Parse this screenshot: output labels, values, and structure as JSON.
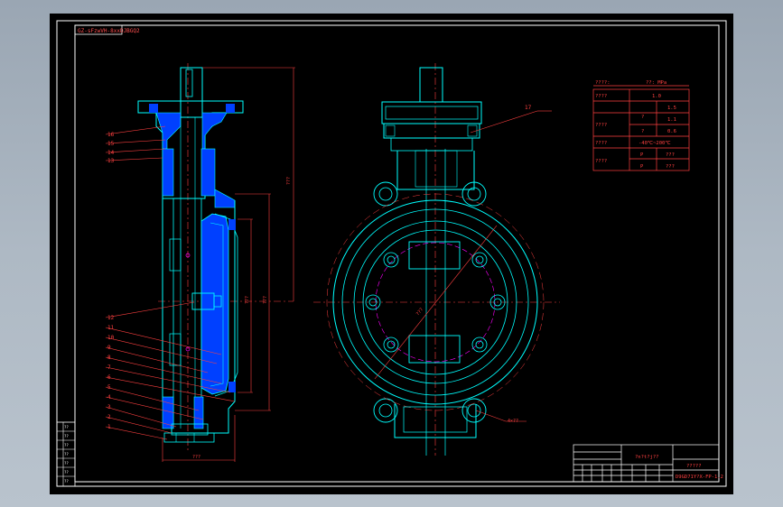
{
  "drawing": {
    "corner_code": "GZ-sFzwVH-8xxDJBGQ2",
    "spec_table": {
      "header_left": "????:",
      "header_right": "??:  MPa",
      "rows": [
        {
          "label": "????",
          "sub": "",
          "value": "1.0"
        },
        {
          "label": "????",
          "sub": "?",
          "value": "1.5"
        },
        {
          "label": "",
          "sub": "",
          "value": "1.1"
        },
        {
          "label": "",
          "sub": "?",
          "value": "0.6"
        },
        {
          "label": "????",
          "sub": "",
          "value": "-40℃~200℃"
        },
        {
          "label": "????",
          "sub": "P",
          "value": "???"
        },
        {
          "label": "",
          "sub": "P",
          "value": "???"
        }
      ]
    },
    "part_numbers_upper": [
      "16",
      "15",
      "14",
      "13"
    ],
    "part_numbers_lower": [
      "12",
      "11",
      "10",
      "9",
      "8",
      "7",
      "6",
      "5",
      "4",
      "3",
      "2",
      "1"
    ],
    "callout_17": "17",
    "dim_vertical_long": "???",
    "dim_inner": "???",
    "dim_inner2": "???",
    "dim_bottom": "???",
    "dim_diag": "???",
    "dim_hole": "4×??",
    "title_block": {
      "company": "?n?t?j??",
      "product": "?????",
      "drawing_no": "D9GD71Y?X-FP-1.2"
    },
    "side_strip_labels": [
      "??",
      "??",
      "??",
      "??",
      "??",
      "??",
      "??"
    ]
  }
}
